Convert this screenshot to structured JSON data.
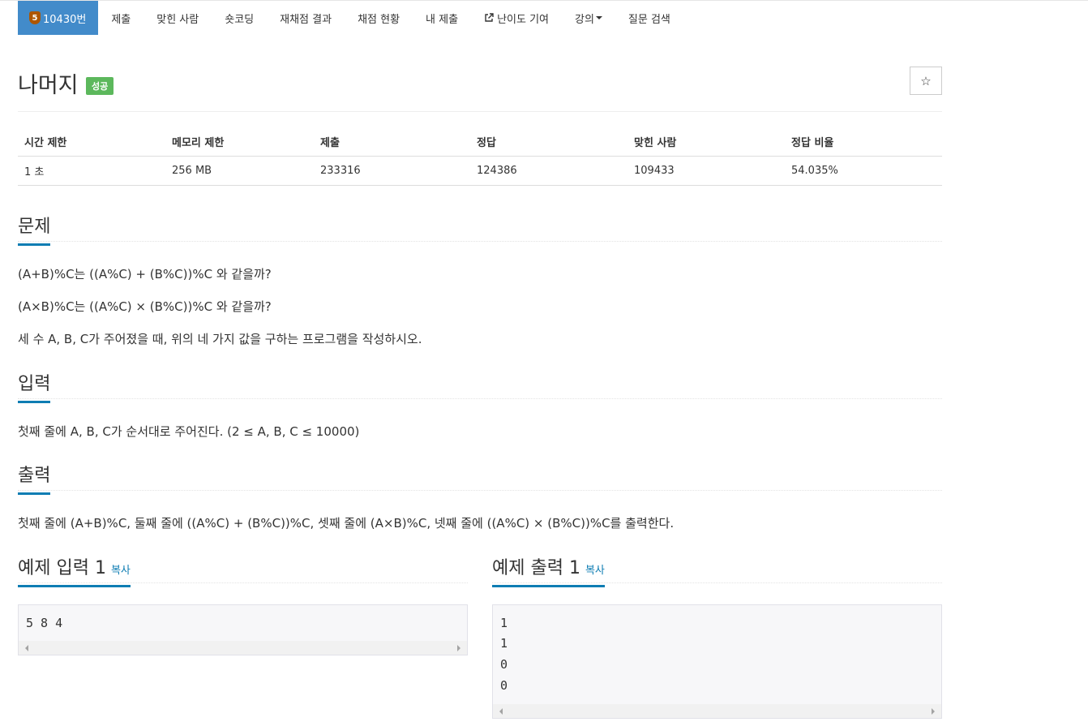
{
  "nav": {
    "problem_id": "10430번",
    "tier_badge": "5",
    "items": [
      "제출",
      "맞힌 사람",
      "숏코딩",
      "재채점 결과",
      "채점 현황",
      "내 제출",
      "난이도 기여",
      "강의",
      "질문 검색"
    ]
  },
  "problem": {
    "title": "나머지",
    "status": "성공",
    "star": "☆"
  },
  "info": {
    "headers": [
      "시간 제한",
      "메모리 제한",
      "제출",
      "정답",
      "맞힌 사람",
      "정답 비율"
    ],
    "values": [
      "1 초",
      "256 MB",
      "233316",
      "124386",
      "109433",
      "54.035%"
    ]
  },
  "sections": {
    "description": {
      "heading": "문제",
      "lines": [
        "(A+B)%C는 ((A%C) + (B%C))%C 와 같을까?",
        "(A×B)%C는 ((A%C) × (B%C))%C 와 같을까?",
        "세 수 A, B, C가 주어졌을 때, 위의 네 가지 값을 구하는 프로그램을 작성하시오."
      ]
    },
    "input": {
      "heading": "입력",
      "text": "첫째 줄에 A, B, C가 순서대로 주어진다. (2 ≤ A, B, C ≤ 10000)"
    },
    "output": {
      "heading": "출력",
      "text": "첫째 줄에 (A+B)%C, 둘째 줄에 ((A%C) + (B%C))%C, 셋째 줄에 (A×B)%C, 넷째 줄에 ((A%C) × (B%C))%C를 출력한다."
    }
  },
  "samples": {
    "copy_label": "복사",
    "input": {
      "heading": "예제 입력 1",
      "lines": [
        "5 8 4"
      ]
    },
    "output": {
      "heading": "예제 출력 1",
      "lines": [
        "1",
        "1",
        "0",
        "0"
      ]
    }
  },
  "colors": {
    "nav_active": "#428bca",
    "accent": "#0e7db3",
    "success": "#5cb85c",
    "tier_bronze": "#ad5600"
  }
}
